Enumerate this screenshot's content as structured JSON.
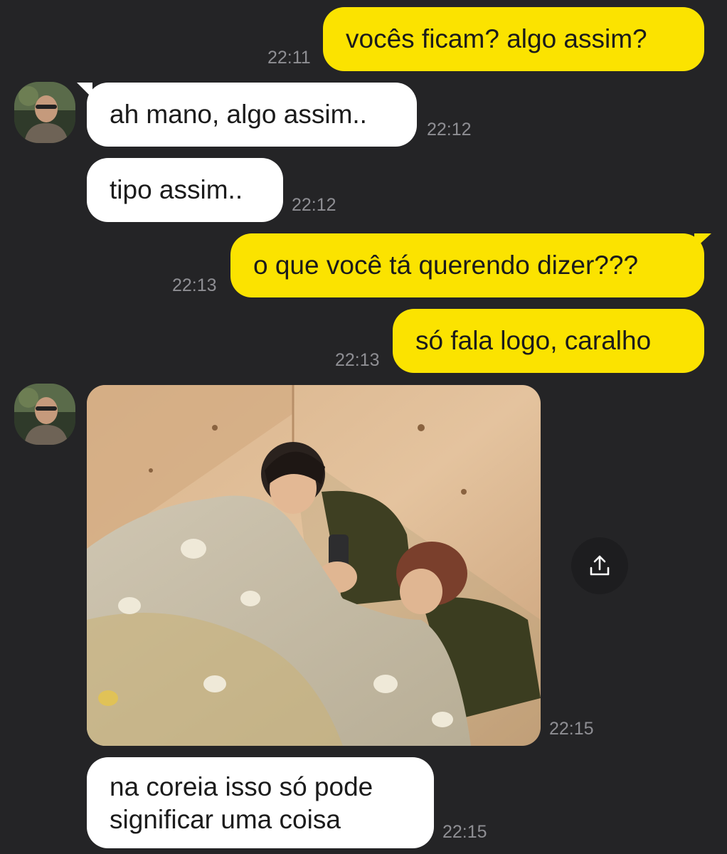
{
  "messages": [
    {
      "sender": "me",
      "text": "vocês ficam? algo assim?",
      "time": "22:11"
    },
    {
      "sender": "them",
      "text": "ah mano, algo assim..",
      "time": "22:12"
    },
    {
      "sender": "them",
      "text": "tipo assim..",
      "time": "22:12"
    },
    {
      "sender": "me",
      "text": "o que você tá querendo dizer???",
      "time": "22:13"
    },
    {
      "sender": "me",
      "text": "só fala logo, caralho",
      "time": "22:13"
    },
    {
      "sender": "them",
      "type": "image",
      "time": "22:15"
    },
    {
      "sender": "them",
      "text_line1": "na coreia isso só pode",
      "text_line2": "significar uma coisa",
      "time": "22:15"
    }
  ],
  "icons": {
    "share": "share-icon",
    "avatar": "avatar"
  },
  "colors": {
    "background": "#242426",
    "outgoing_bubble": "#fbe300",
    "incoming_bubble": "#ffffff",
    "timestamp": "#8e8e93"
  }
}
